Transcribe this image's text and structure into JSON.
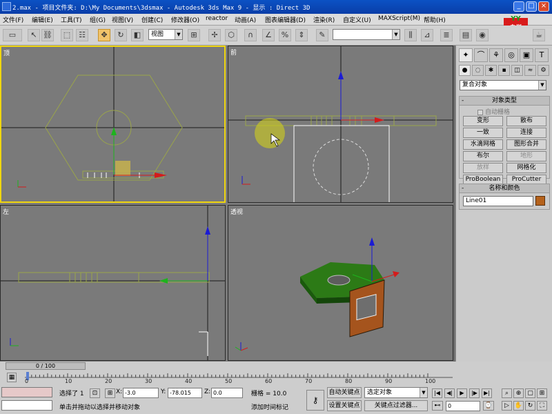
{
  "window": {
    "title": "2.max   - 项目文件夹: D:\\My Documents\\3dsmax   - Autodesk 3ds Max 9   - 显示 : Direct 3D",
    "minimize": "_",
    "maximize": "□",
    "close": "×"
  },
  "brand": {
    "top": "YY",
    "line1": "自学",
    "line2": "软件"
  },
  "menu": [
    "文件(F)",
    "编辑(E)",
    "工具(T)",
    "组(G)",
    "视图(V)",
    "创建(C)",
    "修改器(O)",
    "reactor",
    "动画(A)",
    "图表编辑器(D)",
    "渲染(R)",
    "自定义(U)",
    "MAXScript(M)",
    "帮助(H)"
  ],
  "toolbar": {
    "undo": "↶",
    "redo": "↷",
    "select_filter": "",
    "coord_system": "视图",
    "named_selection": ""
  },
  "viewports": {
    "top": "顶",
    "front": "前",
    "left": "左",
    "perspective": "透视"
  },
  "panel": {
    "category": "复合对象",
    "object_type_header": "对象类型",
    "autogrid": "自动栅格",
    "buttons": [
      {
        "label": "变形",
        "enabled": true
      },
      {
        "label": "散布",
        "enabled": true
      },
      {
        "label": "一致",
        "enabled": true
      },
      {
        "label": "连接",
        "enabled": true
      },
      {
        "label": "水滴网格",
        "enabled": true
      },
      {
        "label": "图形合并",
        "enabled": true
      },
      {
        "label": "布尔",
        "enabled": true
      },
      {
        "label": "地形",
        "enabled": false
      },
      {
        "label": "放样",
        "enabled": false
      },
      {
        "label": "网格化",
        "enabled": true
      },
      {
        "label": "ProBoolean",
        "enabled": true
      },
      {
        "label": "ProCutter",
        "enabled": true
      }
    ],
    "name_color_header": "名称和颜色",
    "object_name": "Line01",
    "object_color": "#b5621c"
  },
  "timeline": {
    "frame_display": "0 / 100",
    "tick_labels": [
      "0",
      "10",
      "20",
      "30",
      "40",
      "50",
      "60",
      "70",
      "80",
      "90",
      "100"
    ]
  },
  "status": {
    "selection": "选择了 1 ",
    "x_label": "X:",
    "x_value": "-3.0",
    "y_label": "Y:",
    "y_value": "-78.015",
    "z_label": "Z:",
    "z_value": "0.0",
    "grid": "栅格 = 10.0",
    "auto_key": "自动关键点",
    "selected_filter": "选定对象",
    "set_key": "设置关键点",
    "key_filters": "关键点过滤器...",
    "add_time_tag": "添加时间标记",
    "prompt": "单击并拖动以选择并移动对象",
    "current_frame": "0"
  }
}
